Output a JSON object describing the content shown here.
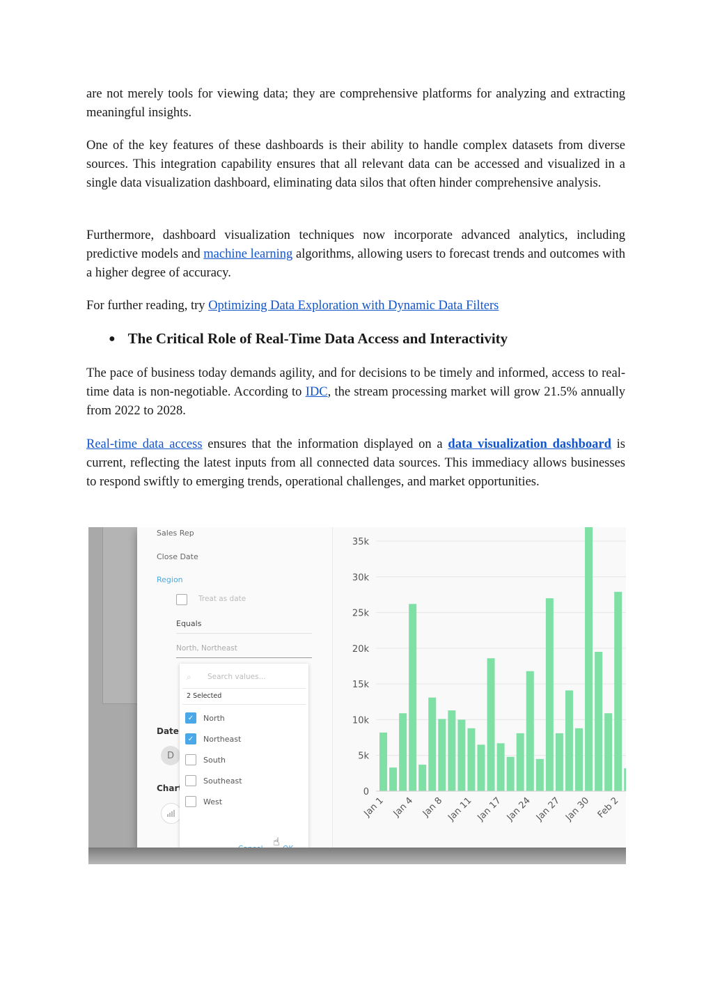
{
  "article": {
    "p1": "are not merely tools for viewing data; they are comprehensive platforms for analyzing and extracting meaningful insights.",
    "p2": "One of the key features of these dashboards is their ability to handle complex datasets from diverse sources. This integration capability ensures that all relevant data can be accessed and visualized in a single data visualization dashboard, eliminating data silos that often hinder comprehensive analysis.",
    "p3_before": "Furthermore, dashboard visualization techniques now incorporate advanced analytics, including predictive models and ",
    "p3_link": "machine learning",
    "p3_after": " algorithms, allowing users to forecast trends and outcomes with a higher degree of accuracy.",
    "p4_before": "For further reading, try ",
    "p4_link": "Optimizing Data Exploration with Dynamic Data Filters",
    "heading_bullet": "●",
    "heading": "The Critical Role of Real-Time Data Access and Interactivity",
    "p5_before": "The pace of business today demands agility, and for decisions to be timely and informed, access to real-time data is non-negotiable. According to ",
    "p5_link": "IDC",
    "p5_after": ", the stream processing market will grow 21.5% annually from 2022 to 2028.",
    "p6_link1": "Real-time data access",
    "p6_mid": " ensures that the information displayed on a ",
    "p6_link2": "data visualization dashboard",
    "p6_after": " is current, reflecting the latest inputs from all connected data sources. This immediacy allows businesses to respond swiftly to emerging trends, operational challenges, and market opportunities.",
    "link_color": "#1155cc"
  },
  "screenshot": {
    "background_chart": {
      "yticks": [
        "25k",
        "20k",
        "15k",
        "10k",
        "5k",
        "0"
      ],
      "xlabel": "Jan"
    },
    "fields": [
      "Sales Rep",
      "Close Date",
      "Region"
    ],
    "active_field": "Region",
    "treat_as_date": "Treat as date",
    "operator": "Equals",
    "selected_values_text": "North,  Northeast",
    "date_section": "Date",
    "date_circle": "D",
    "chart_section": "Chart",
    "chart_circle_icon": "bar-chart-icon",
    "dropdown": {
      "search_placeholder": "Search values...",
      "search_icon": "search-icon",
      "count_label": "2 Selected",
      "options": [
        {
          "label": "North",
          "checked": true
        },
        {
          "label": "Northeast",
          "checked": true
        },
        {
          "label": "South",
          "checked": false
        },
        {
          "label": "Southeast",
          "checked": false
        },
        {
          "label": "West",
          "checked": false
        }
      ],
      "cancel_label": "Cancel",
      "ok_label": "OK"
    },
    "accent_color": "#4da9e0",
    "bar_color": "#7fe0a5"
  },
  "chart_data": {
    "type": "bar",
    "title": "",
    "xlabel": "",
    "ylabel": "",
    "ylim": [
      0,
      37000
    ],
    "yticks": [
      0,
      5000,
      10000,
      15000,
      20000,
      25000,
      30000,
      35000
    ],
    "ytick_labels": [
      "0",
      "5k",
      "10k",
      "15k",
      "20k",
      "25k",
      "30k",
      "35k"
    ],
    "xtick_labels": [
      "Jan 1",
      "Jan 4",
      "Jan 8",
      "Jan 11",
      "Jan 17",
      "Jan 24",
      "Jan 27",
      "Jan 30",
      "Feb 2"
    ],
    "grid": true,
    "legend": "none",
    "values": [
      8200,
      3300,
      10900,
      26200,
      3700,
      13100,
      10100,
      11300,
      10000,
      8800,
      6500,
      18600,
      6700,
      4800,
      8100,
      16800,
      4500,
      27000,
      8100,
      14100,
      8800,
      37000,
      19500,
      10900,
      27900,
      3200
    ]
  }
}
